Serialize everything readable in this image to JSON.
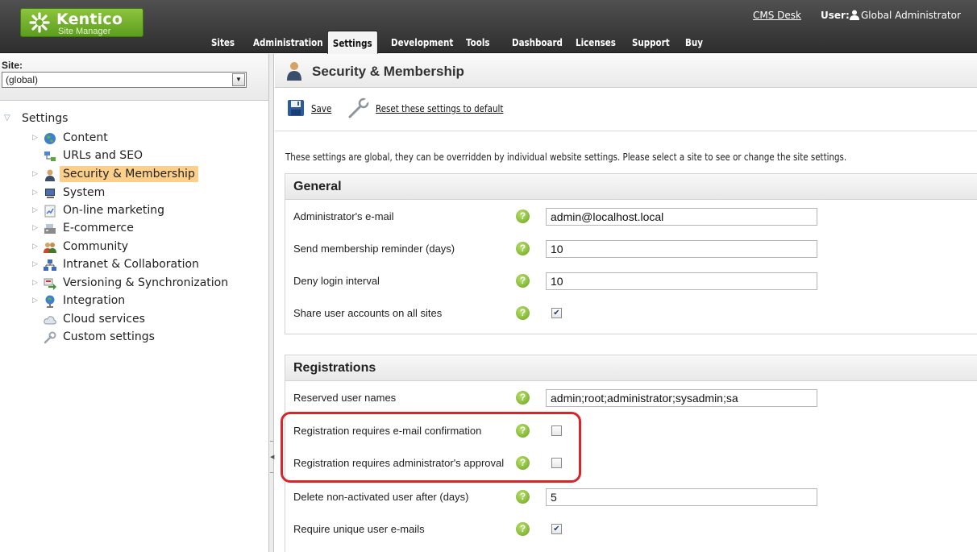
{
  "header": {
    "logo_name": "Kentico",
    "logo_subtitle": "Site Manager",
    "tabs": [
      {
        "label": "Sites",
        "active": false
      },
      {
        "label": "Administration",
        "active": false
      },
      {
        "label": "Settings",
        "active": true
      },
      {
        "label": "Development",
        "active": false
      },
      {
        "label": "Tools",
        "active": false
      },
      {
        "label": "Dashboard",
        "active": false
      },
      {
        "label": "Licenses",
        "active": false
      },
      {
        "label": "Support",
        "active": false
      },
      {
        "label": "Buy",
        "active": false
      }
    ],
    "cms_desk_link": "CMS Desk",
    "user_label": "User:",
    "user_name": "Global Administrator"
  },
  "left_panel": {
    "site_label": "Site:",
    "site_value": "(global)",
    "tree_root": "Settings",
    "tree_items": [
      {
        "label": "Content",
        "icon": "globe-icon",
        "expandable": true,
        "selected": false
      },
      {
        "label": "URLs and SEO",
        "icon": "sitemap-icon",
        "expandable": false,
        "selected": false
      },
      {
        "label": "Security & Membership",
        "icon": "user-icon",
        "expandable": true,
        "selected": true
      },
      {
        "label": "System",
        "icon": "monitor-icon",
        "expandable": true,
        "selected": false
      },
      {
        "label": "On-line marketing",
        "icon": "chart-icon",
        "expandable": true,
        "selected": false
      },
      {
        "label": "E-commerce",
        "icon": "cash-register-icon",
        "expandable": true,
        "selected": false
      },
      {
        "label": "Community",
        "icon": "group-icon",
        "expandable": true,
        "selected": false
      },
      {
        "label": "Intranet & Collaboration",
        "icon": "network-icon",
        "expandable": true,
        "selected": false
      },
      {
        "label": "Versioning & Synchronization",
        "icon": "sync-icon",
        "expandable": true,
        "selected": false
      },
      {
        "label": "Integration",
        "icon": "globe-stand-icon",
        "expandable": true,
        "selected": false
      },
      {
        "label": "Cloud services",
        "icon": "cloud-icon",
        "expandable": false,
        "selected": false
      },
      {
        "label": "Custom settings",
        "icon": "wrench-icon",
        "expandable": false,
        "selected": false
      }
    ]
  },
  "main": {
    "title": "Security & Membership",
    "toolbar": {
      "save_label": "Save",
      "reset_label": "Reset these settings to default"
    },
    "info_text": "These settings are global, they can be overridden by individual website settings. Please select a site to see or change the site settings.",
    "sections": [
      {
        "title": "General",
        "rows": [
          {
            "label": "Administrator's e-mail",
            "type": "text",
            "value": "admin@localhost.local"
          },
          {
            "label": "Send membership reminder (days)",
            "type": "text",
            "value": "10"
          },
          {
            "label": "Deny login interval",
            "type": "text",
            "value": "10"
          },
          {
            "label": "Share user accounts on all sites",
            "type": "checkbox",
            "checked": true
          }
        ]
      },
      {
        "title": "Registrations",
        "rows": [
          {
            "label": "Reserved user names",
            "type": "text",
            "value": "admin;root;administrator;sysadmin;sa"
          },
          {
            "label": "Registration requires e-mail confirmation",
            "type": "checkbox",
            "checked": false
          },
          {
            "label": "Registration requires administrator's approval",
            "type": "checkbox",
            "checked": false
          },
          {
            "label": "Delete non-activated user after (days)",
            "type": "text",
            "value": "5"
          },
          {
            "label": "Require unique user e-mails",
            "type": "checkbox",
            "checked": true
          }
        ]
      }
    ],
    "help_glyph": "?",
    "check_glyph": "✔"
  },
  "colors": {
    "header_bg": "#3c3c3c",
    "logo_green": "#7ab833",
    "selected_tree_bg": "#fcd08a",
    "highlight_red": "#d6262c",
    "help_green": "#8cc43c"
  }
}
